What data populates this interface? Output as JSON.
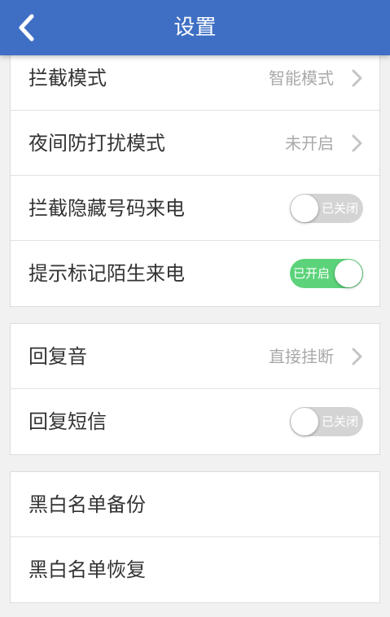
{
  "header": {
    "title": "设置",
    "back_icon": "chevron-left-icon"
  },
  "group1": [
    {
      "label": "拦截模式",
      "value": "智能模式"
    },
    {
      "label": "夜间防打扰模式",
      "value": "未开启"
    },
    {
      "label": "拦截隐藏号码来电",
      "toggle_state": "off",
      "toggle_text": "已关闭"
    },
    {
      "label": "提示标记陌生来电",
      "toggle_state": "on",
      "toggle_text": "已开启"
    }
  ],
  "group2": [
    {
      "label": "回复音",
      "value": "直接挂断"
    },
    {
      "label": "回复短信",
      "toggle_state": "off",
      "toggle_text": "已关闭"
    }
  ],
  "group3": [
    {
      "label": "黑白名单备份"
    },
    {
      "label": "黑白名单恢复"
    }
  ],
  "colors": {
    "header": "#3f6fc4",
    "toggle_on": "#5cd37a",
    "toggle_off": "#d4d4d4"
  }
}
